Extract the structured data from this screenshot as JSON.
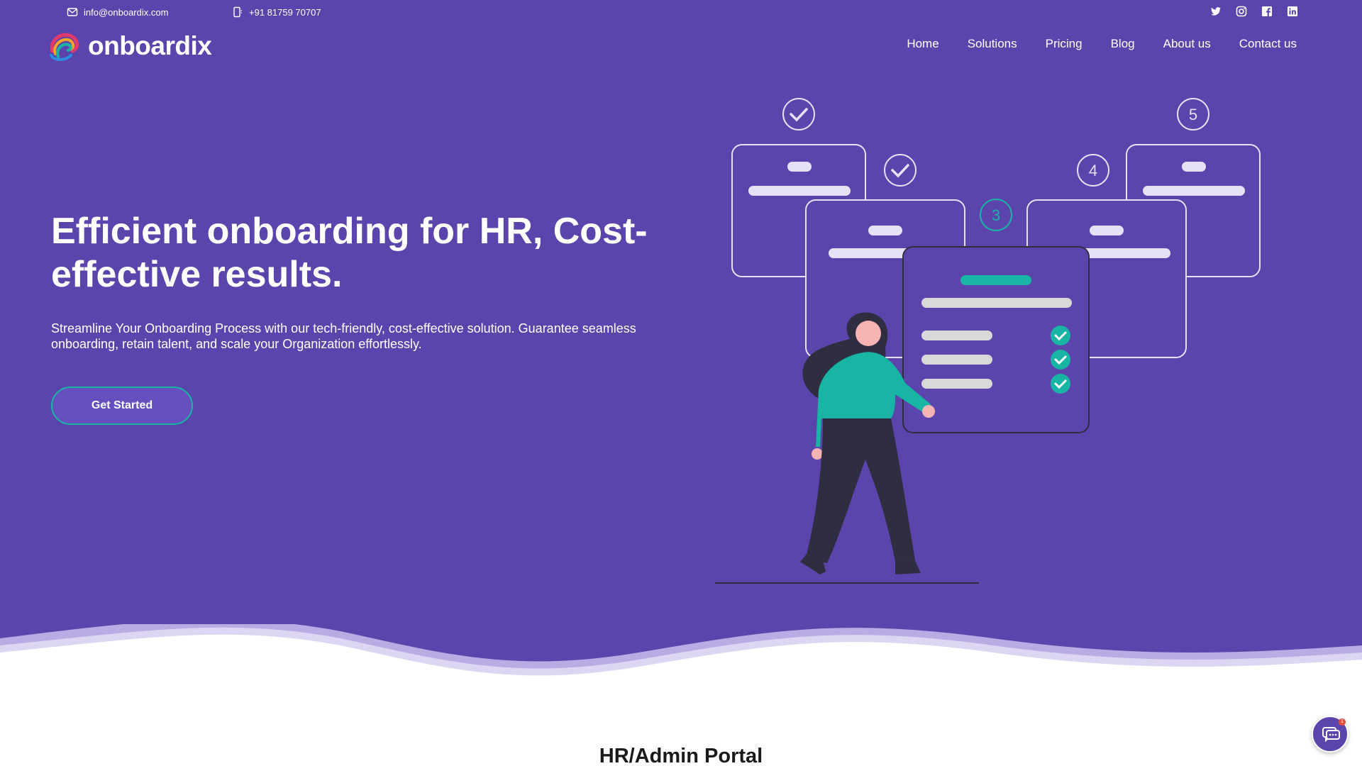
{
  "topbar": {
    "email": "info@onboardix.com",
    "phone": "+91 81759 70707",
    "email_icon": "mail-icon",
    "phone_icon": "phone-icon",
    "socials": [
      "twitter-icon",
      "instagram-icon",
      "facebook-icon",
      "linkedin-icon"
    ]
  },
  "brand": {
    "name": "onboardix"
  },
  "nav": {
    "items": [
      "Home",
      "Solutions",
      "Pricing",
      "Blog",
      "About us",
      "Contact us"
    ]
  },
  "hero": {
    "title": "Efficient onboarding for HR, Cost-effective results.",
    "subtitle": "Streamline Your Onboarding Process with our tech-friendly, cost-effective solution. Guarantee seamless onboarding, retain talent, and scale your Organization effortlessly.",
    "cta_label": "Get Started",
    "steps": [
      "3",
      "4",
      "5"
    ]
  },
  "section": {
    "title": "HR/Admin Portal"
  },
  "chat": {
    "badge": "1",
    "icon": "chat-icon"
  },
  "colors": {
    "primary": "#5b45ad",
    "accent": "#18b4a4",
    "white": "#ffffff"
  }
}
